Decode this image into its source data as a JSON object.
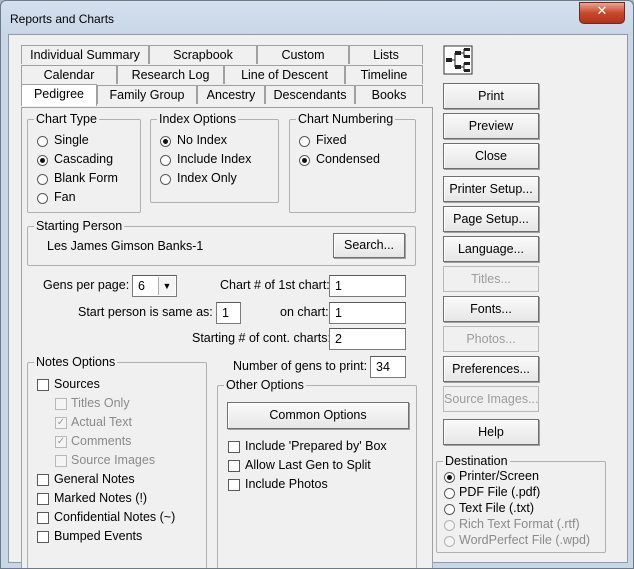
{
  "window": {
    "title": "Reports and Charts",
    "close_glyph": "✕"
  },
  "tabs": {
    "row1": [
      "Individual Summary",
      "Scrapbook",
      "Custom",
      "Lists"
    ],
    "row2": [
      "Calendar",
      "Research Log",
      "Line of Descent",
      "Timeline"
    ],
    "row3": [
      "Pedigree",
      "Family Group",
      "Ancestry",
      "Descendants",
      "Books"
    ]
  },
  "chart_type": {
    "title": "Chart Type",
    "options": [
      "Single",
      "Cascading",
      "Blank Form",
      "Fan"
    ],
    "selected": "Cascading"
  },
  "index_options": {
    "title": "Index Options",
    "options": [
      "No Index",
      "Include Index",
      "Index Only"
    ],
    "selected": "No Index"
  },
  "chart_numbering": {
    "title": "Chart Numbering",
    "options": [
      "Fixed",
      "Condensed"
    ],
    "selected": "Condensed"
  },
  "starting_person": {
    "title": "Starting Person",
    "name": "Les James Gimson Banks-1",
    "search_label": "Search..."
  },
  "fields": {
    "gens_per_page_label": "Gens per page:",
    "gens_per_page_value": "6",
    "chart_first_label": "Chart # of 1st chart:",
    "chart_first_value": "1",
    "start_same_label": "Start person is same as:",
    "start_same_value": "1",
    "on_chart_label": "on chart:",
    "on_chart_value": "1",
    "starting_cont_label": "Starting # of cont. charts:",
    "starting_cont_value": "2",
    "num_gens_label": "Number of gens to print:",
    "num_gens_value": "34"
  },
  "notes_options": {
    "title": "Notes Options",
    "sources": "Sources",
    "sub": [
      "Titles Only",
      "Actual Text",
      "Comments",
      "Source Images"
    ],
    "sub_checked": [
      false,
      true,
      true,
      false
    ],
    "items": [
      "General Notes",
      "Marked Notes (!)",
      "Confidential Notes (~)",
      "Bumped Events"
    ]
  },
  "other_options": {
    "title": "Other Options",
    "common_label": "Common Options",
    "items": [
      "Include 'Prepared by' Box",
      "Allow Last Gen to Split",
      "Include Photos"
    ]
  },
  "buttons": {
    "print": "Print",
    "preview": "Preview",
    "close": "Close",
    "printer_setup": "Printer Setup...",
    "page_setup": "Page Setup...",
    "language": "Language...",
    "titles": "Titles...",
    "fonts": "Fonts...",
    "photos": "Photos...",
    "preferences": "Preferences...",
    "source_images": "Source Images...",
    "help": "Help"
  },
  "destination": {
    "title": "Destination",
    "options": [
      "Printer/Screen",
      "PDF File (.pdf)",
      "Text File (.txt)",
      "Rich Text Format (.rtf)",
      "WordPerfect File (.wpd)"
    ],
    "selected": "Printer/Screen"
  },
  "icons": {
    "chart_icon": "pedigree-chart-icon",
    "close": "close-icon"
  },
  "colors": {
    "close_button": "#c7482b",
    "title_bar": "#d4e0ee"
  }
}
